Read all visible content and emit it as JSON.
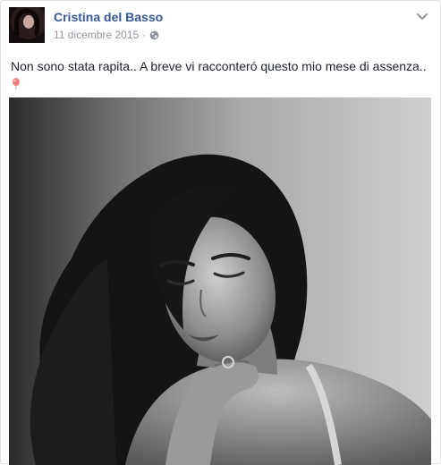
{
  "post": {
    "author": "Cristina del Basso",
    "date": "11 dicembre 2015",
    "separator": "·",
    "privacy_icon": "globe-icon",
    "options_icon": "chevron-down-icon",
    "text": "Non sono stata rapita.. A breve vi racconteró questo mio mese di assenza..",
    "emoji_icon": "balloon-icon",
    "image_alt": "photo"
  },
  "colors": {
    "author_link": "#365899",
    "meta_gray": "#90949c",
    "text": "#1d2129",
    "border": "#dddfe2"
  }
}
